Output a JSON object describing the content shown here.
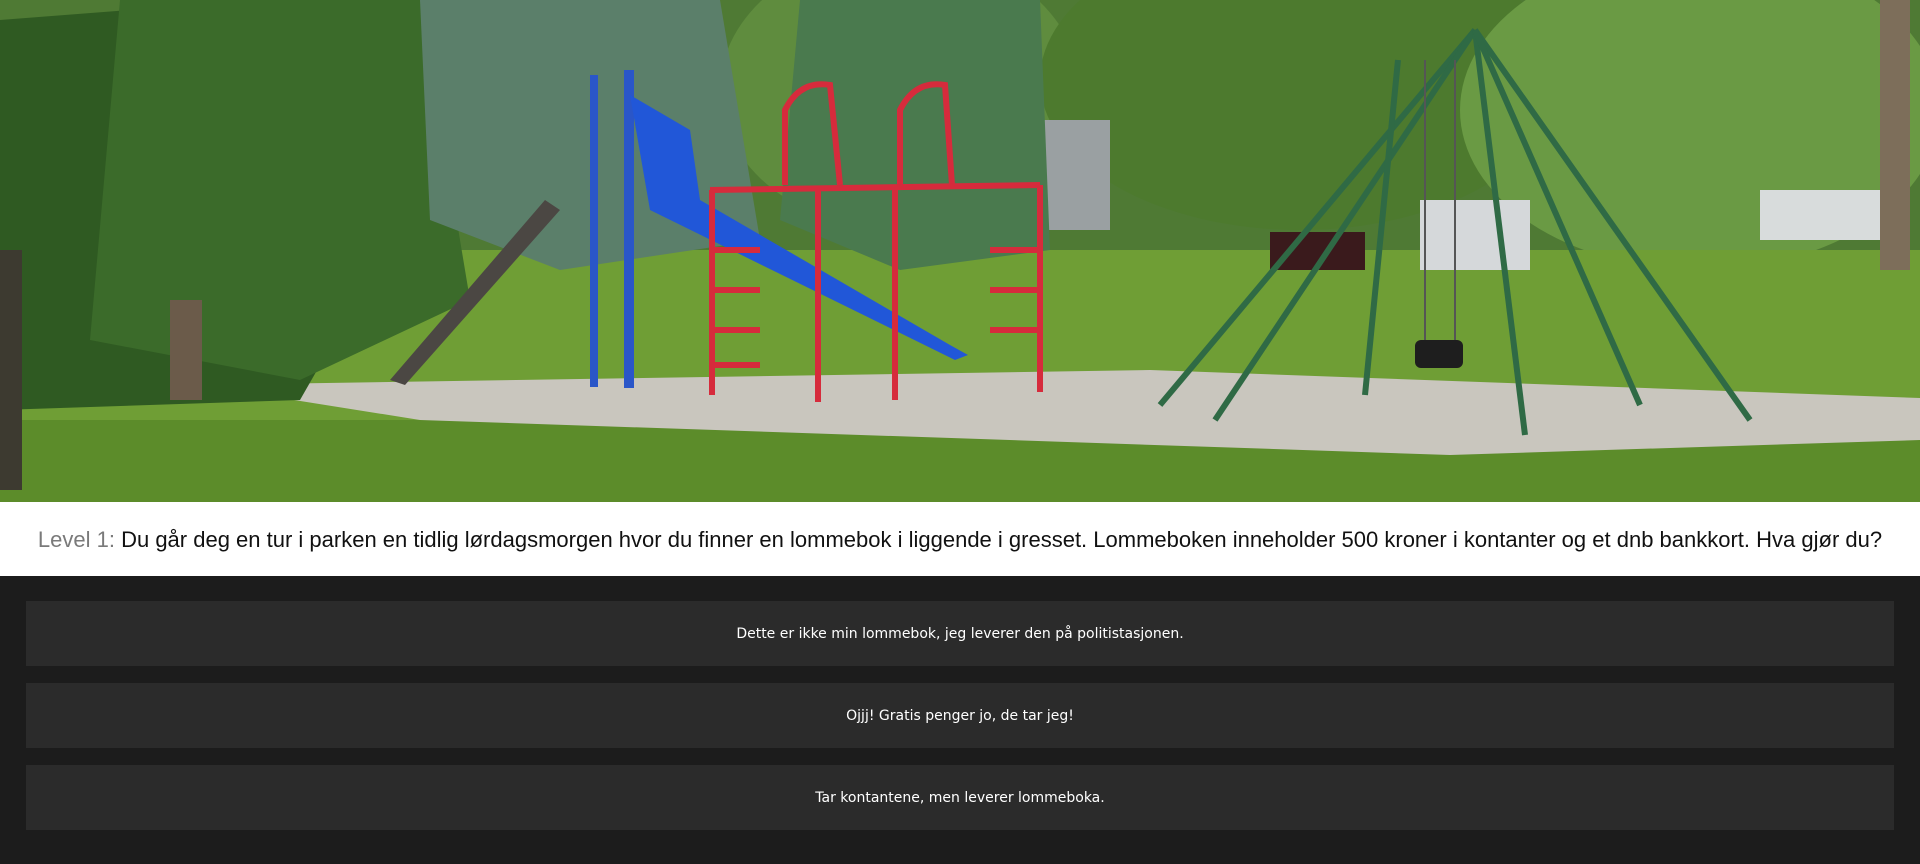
{
  "scene": {
    "image_description_icon": "playground-park-scene"
  },
  "question": {
    "level_label": "Level 1:",
    "text": "Du går deg en tur i parken en tidlig lørdagsmorgen hvor du finner en lommebok i liggende i gresset. Lommeboken inneholder 500 kroner i kontanter og et dnb bankkort. Hva gjør du?"
  },
  "answers": [
    {
      "label": "Dette er ikke min lommebok, jeg leverer den på politistasjonen."
    },
    {
      "label": "Ojjj! Gratis penger jo, de tar jeg!"
    },
    {
      "label": "Tar kontantene, men leverer lommeboka."
    }
  ],
  "colors": {
    "background": "#1c1c1c",
    "answer_bg": "#2b2b2b",
    "question_bg": "#ffffff",
    "level_label": "#7a7a7a"
  }
}
